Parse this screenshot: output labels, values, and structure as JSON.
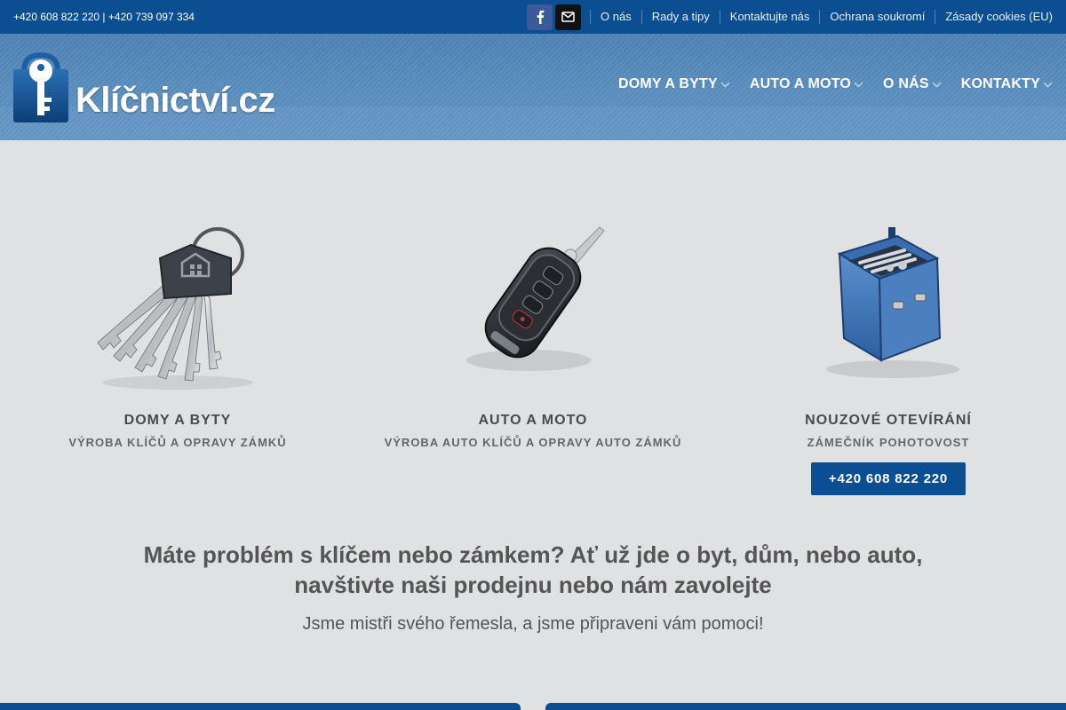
{
  "topbar": {
    "phones": "+420 608 822 220 | +420 739 097 334",
    "links": [
      "O nás",
      "Rady a tipy",
      "Kontaktujte nás",
      "Ochrana soukromí",
      "Zásady cookies (EU)"
    ]
  },
  "header": {
    "logo_text": "Klíčnictví.cz",
    "nav": [
      "DOMY A BYTY",
      "AUTO A MOTO",
      "O NÁS",
      "KONTAKTY"
    ]
  },
  "features": [
    {
      "title": "DOMY A BYTY",
      "subtitle": "VÝROBA KLÍČŮ A OPRAVY ZÁMKŮ",
      "icon": "house-keys-icon"
    },
    {
      "title": "AUTO A MOTO",
      "subtitle": "VÝROBA AUTO KLÍČŮ A OPRAVY AUTO ZÁMKŮ",
      "icon": "car-key-icon"
    },
    {
      "title": "NOUZOVÉ OTEVÍRÁNÍ",
      "subtitle": "ZÁMEČNÍK POHOTOVOST",
      "icon": "toolbox-icon",
      "button": "+420 608 822 220"
    }
  ],
  "headline": {
    "line1": "Máte problém s klíčem nebo zámkem? Ať už jde o byt, dům, nebo auto,",
    "line2": "navštivte naši prodejnu nebo nám zavolejte",
    "sub": "Jsme mistři svého řemesla, a jsme připraveni vám pomoci!"
  },
  "colors": {
    "primary": "#0b4f92",
    "header": "#5a8ec0",
    "background": "#dfe1e3",
    "text": "#555555"
  }
}
